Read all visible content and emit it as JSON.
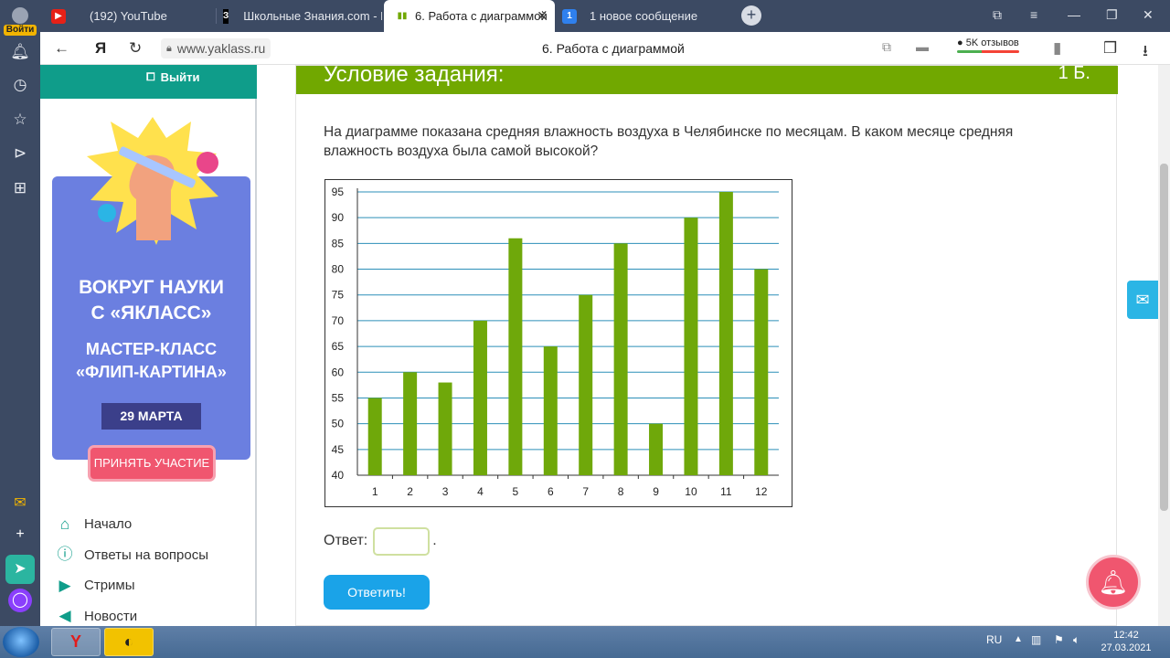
{
  "browser": {
    "tabs": [
      {
        "label": "(192) YouTube",
        "icon": "youtube-icon",
        "active": false
      },
      {
        "label": "Школьные Знания.com - Р",
        "icon": "znania-icon",
        "active": false
      },
      {
        "label": "6. Работа с диаграммой",
        "icon": "yaklass-icon",
        "active": true
      },
      {
        "label": "1 новое сообщение",
        "icon": "message-icon",
        "active": false
      }
    ],
    "login_label": "Войти",
    "url": "www.yaklass.ru",
    "page_title": "6. Работа с диаграммой",
    "reviews_label": "5K отзывов",
    "ya_label": "Я"
  },
  "sidebar": {
    "logout_label": "Выйти",
    "promo": {
      "title_line1": "ВОКРУГ НАУКИ",
      "title_line2": "С «ЯКЛАСС»",
      "sub_line1": "МАСТЕР-КЛАСС",
      "sub_line2": "«ФЛИП-КАРТИНА»",
      "date": "29 МАРТА",
      "cta": "ПРИНЯТЬ УЧАСТИЕ"
    },
    "nav": [
      {
        "label": "Начало",
        "icon": "home-icon"
      },
      {
        "label": "Ответы на вопросы",
        "icon": "question-icon"
      },
      {
        "label": "Стримы",
        "icon": "play-icon"
      },
      {
        "label": "Новости",
        "icon": "megaphone-icon"
      }
    ]
  },
  "task": {
    "header_title": "Условие задания:",
    "points": "1 Б.",
    "question": "На диаграмме показана средняя влажность воздуха в Челябинске по месяцам. В каком месяце средняя влажность воздуха была самой высокой?",
    "answer_label": "Ответ:",
    "answer_value": "",
    "answer_dot": ".",
    "submit_label": "Ответить!"
  },
  "chart_data": {
    "type": "bar",
    "categories": [
      "1",
      "2",
      "3",
      "4",
      "5",
      "6",
      "7",
      "8",
      "9",
      "10",
      "11",
      "12"
    ],
    "values": [
      55,
      60,
      58,
      70,
      86,
      65,
      75,
      85,
      50,
      90,
      95,
      80
    ],
    "ylim": [
      40,
      95
    ],
    "yticks": [
      40,
      45,
      50,
      55,
      60,
      65,
      70,
      75,
      80,
      85,
      90,
      95
    ],
    "title": "",
    "xlabel": "",
    "ylabel": "",
    "grid": true,
    "colors": {
      "bar": "#6fa80a",
      "grid": "#2c8fb8",
      "axis": "#333333"
    }
  },
  "taskbar": {
    "lang": "RU",
    "time": "12:42",
    "date": "27.03.2021"
  },
  "colors": {
    "chrome_dark": "#3c4a63",
    "accent_green": "#71a800",
    "teal": "#0f9d8a",
    "promo_blue": "#6b7fe0",
    "cta_pink": "#f0566f",
    "submit_blue": "#1aa3e8"
  }
}
